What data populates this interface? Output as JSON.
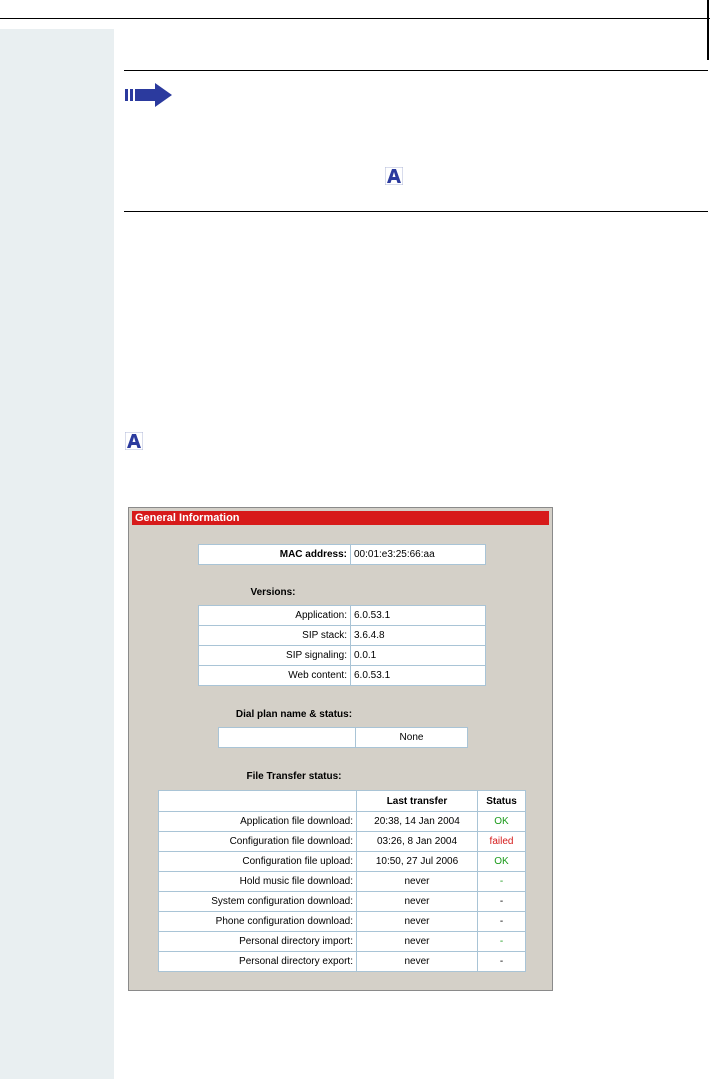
{
  "panel": {
    "title": "General Information",
    "mac": {
      "label": "MAC address:",
      "value": "00:01:e3:25:66:aa"
    },
    "versions_heading": "Versions:",
    "versions": [
      {
        "label": "Application:",
        "value": "6.0.53.1"
      },
      {
        "label": "SIP stack:",
        "value": "3.6.4.8"
      },
      {
        "label": "SIP signaling:",
        "value": "0.0.1"
      },
      {
        "label": "Web content:",
        "value": "6.0.53.1"
      }
    ],
    "dial_plan_heading": "Dial plan name & status:",
    "dial_plan": {
      "name": "",
      "status": "None"
    },
    "file_transfer_heading": "File Transfer status:",
    "file_transfer_columns": [
      "Last transfer",
      "Status"
    ],
    "file_transfer_rows": [
      {
        "label": "Application file download:",
        "last": "20:38, 14 Jan 2004",
        "status": "OK"
      },
      {
        "label": "Configuration file download:",
        "last": "03:26, 8 Jan 2004",
        "status": "failed"
      },
      {
        "label": "Configuration file upload:",
        "last": "10:50, 27 Jul 2006",
        "status": "OK"
      },
      {
        "label": "Hold music file download:",
        "last": "never",
        "status": "-"
      },
      {
        "label": "System configuration download:",
        "last": "never",
        "status": "-"
      },
      {
        "label": "Phone configuration download:",
        "last": "never",
        "status": "-"
      },
      {
        "label": "Personal directory import:",
        "last": "never",
        "status": "-"
      },
      {
        "label": "Personal directory export:",
        "last": "never",
        "status": "-"
      }
    ]
  },
  "colors": {
    "sidebar": "#e9eff1",
    "title_bar": "#d71a1a",
    "ok": "#1a9a1a",
    "failed": "#d41a1a",
    "icon_blue": "#2b3a9e"
  },
  "icons": [
    "arrow-note-icon",
    "admin-a-icon"
  ]
}
